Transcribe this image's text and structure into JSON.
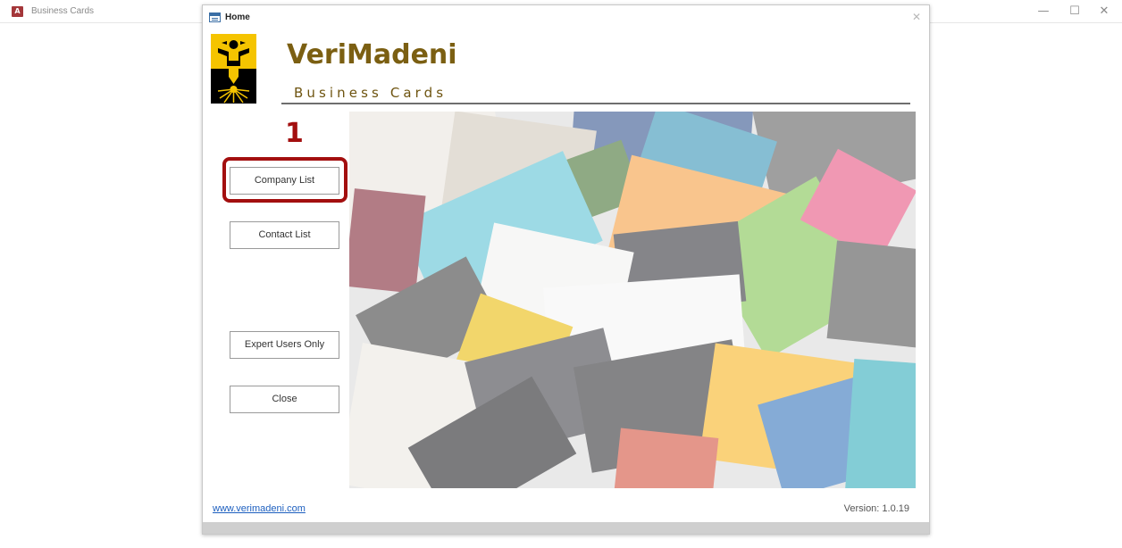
{
  "app": {
    "title": "Business Cards",
    "icon_text": "A",
    "minimize_glyph": "—",
    "maximize_glyph": "☐",
    "close_glyph": "✕"
  },
  "form": {
    "title": "Home",
    "close_glyph": "✕"
  },
  "header": {
    "brand": "VeriMadeni",
    "subtitle": "Business Cards",
    "brand_color": "#7b5f12"
  },
  "nav": {
    "company_list": "Company List",
    "contact_list": "Contact List",
    "expert_users_only": "Expert Users Only",
    "close": "Close"
  },
  "annotation": {
    "step_number": "1",
    "color": "#a30f0f"
  },
  "footer": {
    "website": "www.verimadeni.com",
    "version": "Version: 1.0.19"
  }
}
